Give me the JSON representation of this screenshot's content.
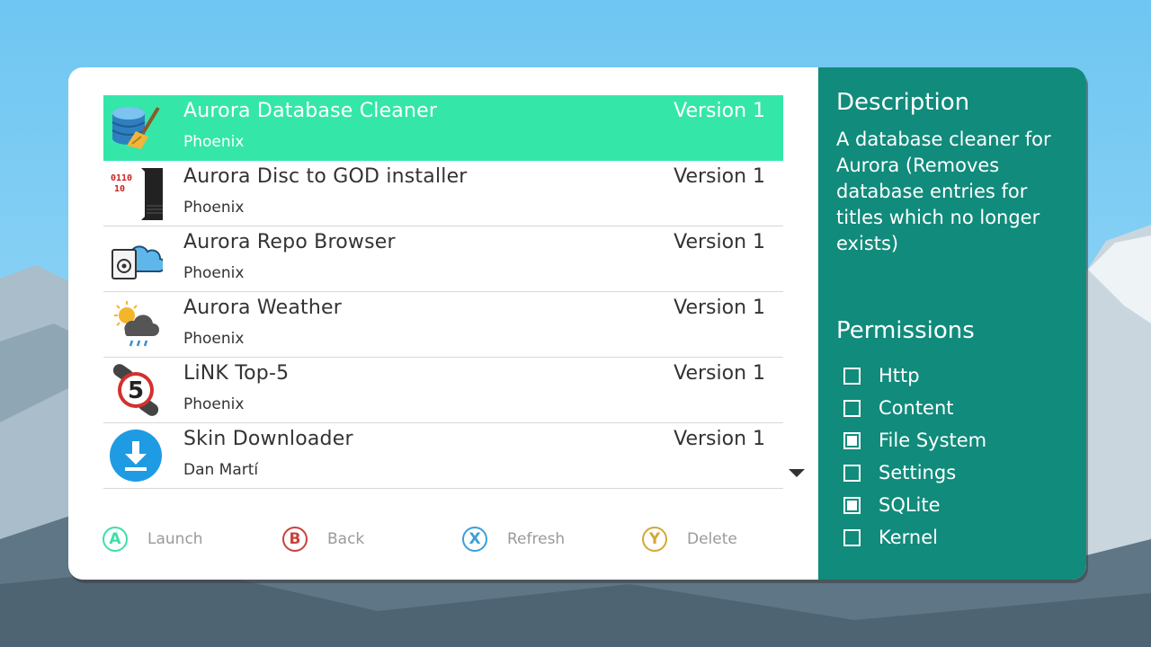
{
  "apps": [
    {
      "name": "Aurora Database Cleaner",
      "author": "Phoenix",
      "version": "Version 1",
      "icon": "database-broom-icon",
      "selected": true
    },
    {
      "name": "Aurora Disc to GOD installer",
      "author": "Phoenix",
      "version": "Version 1",
      "icon": "console-binary-icon",
      "selected": false
    },
    {
      "name": "Aurora Repo Browser",
      "author": "Phoenix",
      "version": "Version 1",
      "icon": "cloud-disc-icon",
      "selected": false
    },
    {
      "name": "Aurora Weather",
      "author": "Phoenix",
      "version": "Version 1",
      "icon": "weather-icon",
      "selected": false
    },
    {
      "name": "LiNK Top-5",
      "author": "Phoenix",
      "version": "Version 1",
      "icon": "link-top5-icon",
      "selected": false
    },
    {
      "name": "Skin Downloader",
      "author": "Dan Martí",
      "version": "Version 1",
      "icon": "download-icon",
      "selected": false
    }
  ],
  "hints": [
    {
      "key": "A",
      "label": "Launch",
      "color": "#3ddfa8"
    },
    {
      "key": "B",
      "label": "Back",
      "color": "#c8423c"
    },
    {
      "key": "X",
      "label": "Refresh",
      "color": "#3a9fdb"
    },
    {
      "key": "Y",
      "label": "Delete",
      "color": "#d4a73a"
    }
  ],
  "details": {
    "description_heading": "Description",
    "description": "A database cleaner for Aurora (Removes database entries for titles which no longer exists)",
    "permissions_heading": "Permissions",
    "permissions": [
      {
        "label": "Http",
        "checked": false
      },
      {
        "label": "Content",
        "checked": false
      },
      {
        "label": "File System",
        "checked": true
      },
      {
        "label": "Settings",
        "checked": false
      },
      {
        "label": "SQLite",
        "checked": true
      },
      {
        "label": "Kernel",
        "checked": false
      }
    ]
  },
  "colors": {
    "selection": "#35e6a9",
    "side_panel": "#118b7b",
    "sky": "#7fcff5"
  }
}
